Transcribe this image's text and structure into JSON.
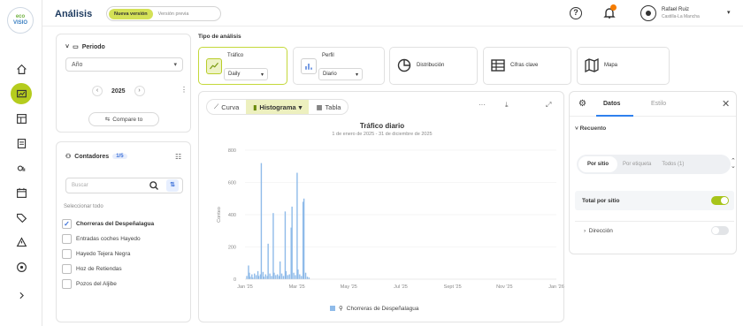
{
  "logo": {
    "line1": "eco",
    "line2": "VISIO"
  },
  "header": {
    "title": "Análisis",
    "version_new": "Nueva versión",
    "version_old": "Versión previa",
    "help": "?",
    "user_name": "Rafael Ruiz",
    "user_region": "Castilla-La Mancha"
  },
  "rail": {
    "icons": [
      "home-icon",
      "analysis-icon",
      "dashboard-icon",
      "report-icon",
      "counter-icon",
      "calendar-icon",
      "tag-icon",
      "alert-icon",
      "target-icon",
      "expand-icon"
    ]
  },
  "period": {
    "title": "Periodo",
    "granularity": "Año",
    "year": "2025",
    "prev": "‹",
    "next": "›",
    "compare": "Compare to"
  },
  "counters": {
    "title": "Contadores",
    "badge": "1/5",
    "search_placeholder": "Buscar",
    "select_all": "Seleccionar todo",
    "items": [
      {
        "label": "Chorreras del Despeñalagua",
        "checked": true
      },
      {
        "label": "Entradas coches Hayedo",
        "checked": false
      },
      {
        "label": "Hayedo Tejera Negra",
        "checked": false
      },
      {
        "label": "Hoz de Retiendas",
        "checked": false
      },
      {
        "label": "Pozos del Aljibe",
        "checked": false
      }
    ]
  },
  "analysis_type": {
    "label": "Tipo de análisis",
    "cards": [
      {
        "name": "Tráfico",
        "select": "Daily"
      },
      {
        "name": "Perfil",
        "select": "Diario"
      },
      {
        "name": "Distribución"
      },
      {
        "name": "Cifras clave"
      },
      {
        "name": "Mapa"
      }
    ]
  },
  "chart_toolbar": {
    "curva": "Curva",
    "histograma": "Histograma",
    "tabla": "Tabla",
    "more": "···"
  },
  "chart_data": {
    "type": "bar",
    "title": "Tráfico diario",
    "subtitle": "1 de enero de 2025 - 31 de diciembre de 2025",
    "ylabel": "Conteo",
    "xlabel": "",
    "ylim": [
      0,
      800
    ],
    "yticks": [
      0,
      200,
      400,
      600,
      800
    ],
    "xticks": [
      "Jan '25",
      "Mar '25",
      "May '25",
      "Jul '25",
      "Sept '25",
      "Nov '25",
      "Jan '26"
    ],
    "x_start_day": 0,
    "x_end_day": 365,
    "series": [
      {
        "name": "Chorreras de Despeñalagua",
        "color": "#8fbbe9",
        "points": [
          [
            2,
            20
          ],
          [
            4,
            85
          ],
          [
            5,
            40
          ],
          [
            6,
            15
          ],
          [
            8,
            30
          ],
          [
            9,
            10
          ],
          [
            11,
            35
          ],
          [
            13,
            25
          ],
          [
            15,
            50
          ],
          [
            16,
            20
          ],
          [
            18,
            30
          ],
          [
            19,
            720
          ],
          [
            21,
            45
          ],
          [
            22,
            15
          ],
          [
            24,
            30
          ],
          [
            26,
            20
          ],
          [
            27,
            220
          ],
          [
            29,
            35
          ],
          [
            31,
            20
          ],
          [
            33,
            410
          ],
          [
            34,
            40
          ],
          [
            36,
            25
          ],
          [
            38,
            30
          ],
          [
            40,
            20
          ],
          [
            41,
            110
          ],
          [
            43,
            35
          ],
          [
            45,
            20
          ],
          [
            47,
            420
          ],
          [
            48,
            50
          ],
          [
            50,
            25
          ],
          [
            52,
            30
          ],
          [
            54,
            320
          ],
          [
            55,
            450
          ],
          [
            57,
            40
          ],
          [
            59,
            25
          ],
          [
            61,
            660
          ],
          [
            62,
            60
          ],
          [
            64,
            30
          ],
          [
            66,
            20
          ],
          [
            68,
            480
          ],
          [
            69,
            500
          ],
          [
            71,
            40
          ],
          [
            73,
            15
          ],
          [
            75,
            10
          ]
        ]
      }
    ]
  },
  "right_panel": {
    "tab_data": "Datos",
    "tab_style": "Estilo",
    "section": "Recuento",
    "seg_options": [
      "Por sitio",
      "Por etiqueta",
      "Todos (1)"
    ],
    "row_total": "Total por sitio",
    "row_direction": "Dirección"
  }
}
